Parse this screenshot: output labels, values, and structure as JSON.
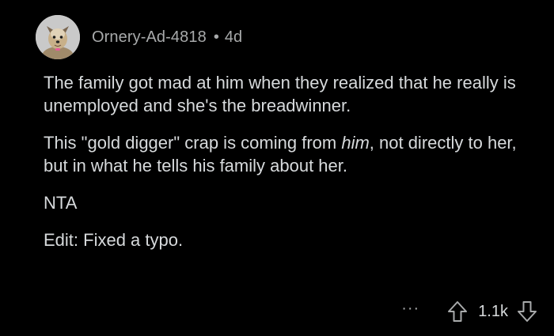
{
  "comment": {
    "author": "Ornery-Ad-4818",
    "separator": "•",
    "age": "4d",
    "avatar": {
      "icon": "dog-avatar-icon"
    },
    "body": {
      "p1": "The family got mad at him when they realized that he really is unemployed and she's the breadwinner.",
      "p2_before": "This \"gold digger\" crap is coming from ",
      "p2_emphasis": "him",
      "p2_after": ", not directly to her, but in what he tells his family about her.",
      "p3": "NTA",
      "p4": "Edit: Fixed a typo."
    },
    "actions": {
      "more": "···",
      "score": "1.1k",
      "upvote_icon": "upvote-arrow-icon",
      "downvote_icon": "downvote-arrow-icon"
    }
  },
  "colors": {
    "background": "#000000",
    "text": "#d7dadc",
    "meta": "#a8aaab"
  }
}
